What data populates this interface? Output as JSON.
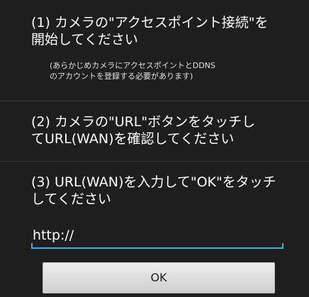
{
  "steps": [
    {
      "text": "(1) カメラの\"アクセスポイント接続\"を\n開始してください",
      "note": "(あらかじめカメラにアクセスポイントとDDNS\nのアカウントを登録する必要があります)"
    },
    {
      "text": "(2) カメラの\"URL\"ボタンをタッチし\nてURL(WAN)を確認してください"
    },
    {
      "text": "(3) URL(WAN)を入力して\"OK\"をタッチ\nしてください"
    }
  ],
  "url_input": {
    "value": "http://"
  },
  "ok_button": {
    "label": "OK"
  },
  "colors": {
    "background": "#000000",
    "panel": "#1e1e1e",
    "accent": "#33b5e5",
    "text": "#ffffff"
  }
}
